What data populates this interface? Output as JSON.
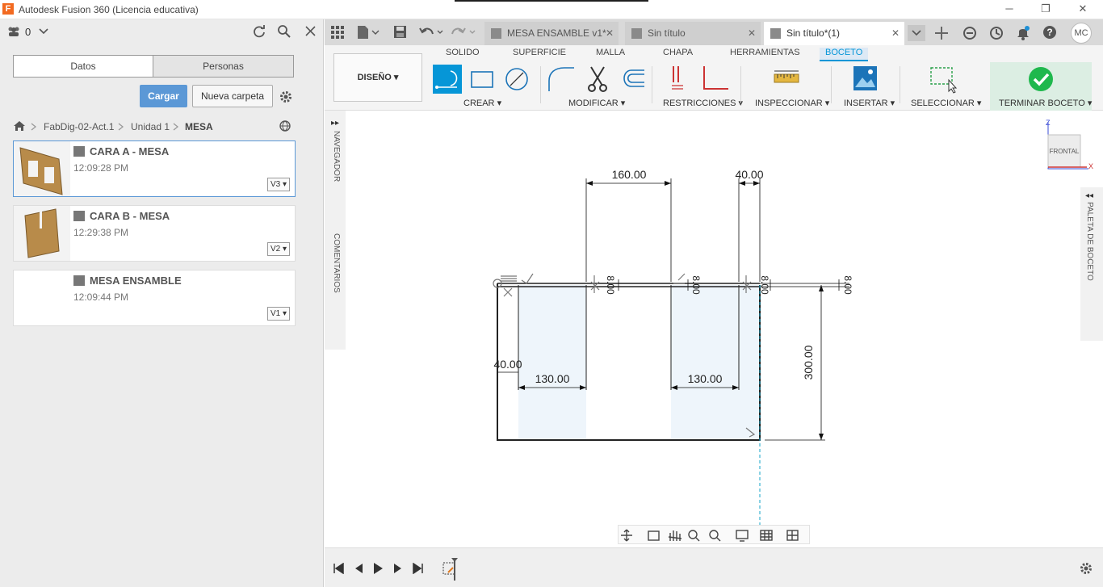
{
  "window": {
    "title": "Autodesk Fusion 360 (Licencia educativa)",
    "app_icon": "F",
    "controls": {
      "minimize": "─",
      "restore": "❐",
      "close": "✕"
    }
  },
  "left_panel": {
    "team_count": "0",
    "segments": {
      "data": "Datos",
      "people": "Personas"
    },
    "upload_label": "Cargar",
    "new_folder_label": "Nueva carpeta",
    "breadcrumb": [
      "FabDig-02-Act.1",
      "Unidad 1",
      "MESA"
    ],
    "files": [
      {
        "name": "CARA A - MESA",
        "time": "12:09:28 PM",
        "version": "V3"
      },
      {
        "name": "CARA B - MESA",
        "time": "12:29:38 PM",
        "version": "V2"
      },
      {
        "name": "MESA ENSAMBLE",
        "time": "12:09:44 PM",
        "version": "V1"
      }
    ]
  },
  "tabs": [
    {
      "label": "MESA ENSAMBLE v1*"
    },
    {
      "label": "Sin título"
    },
    {
      "label": "Sin título*(1)"
    }
  ],
  "user_initials": "MC",
  "toolbar": {
    "workspace": "DISEÑO",
    "menu_tabs": [
      "SOLIDO",
      "SUPERFICIE",
      "MALLA",
      "CHAPA",
      "HERRAMIENTAS",
      "BOCETO"
    ],
    "groups": {
      "create": "CREAR",
      "modify": "MODIFICAR",
      "constraints": "RESTRICCIONES",
      "inspect": "INSPECCIONAR",
      "insert": "INSERTAR",
      "select": "SELECCIONAR",
      "finish": "TERMINAR BOCETO"
    }
  },
  "canvas": {
    "browser_tab": "NAVEGADOR",
    "comments_tab": "COMENTARIOS",
    "palette_tab": "PALETA DE BOCETO",
    "viewcube": "FRONTAL",
    "axis_z": "Z",
    "axis_x": "X",
    "dimensions": {
      "top_160": "160.00",
      "top_40": "40.00",
      "left_40": "40.00",
      "slot_1": "130.00",
      "slot_2": "130.00",
      "height": "300.00",
      "thick_1": "8.00",
      "thick_2": "8.00",
      "thick_3": "8.00",
      "thick_4": "8.00"
    }
  },
  "colors": {
    "accent": "#0696d7",
    "upload_button": "#5b98d6",
    "finish_check": "#1fb84d",
    "sketch_fill": "#eef5fb"
  }
}
